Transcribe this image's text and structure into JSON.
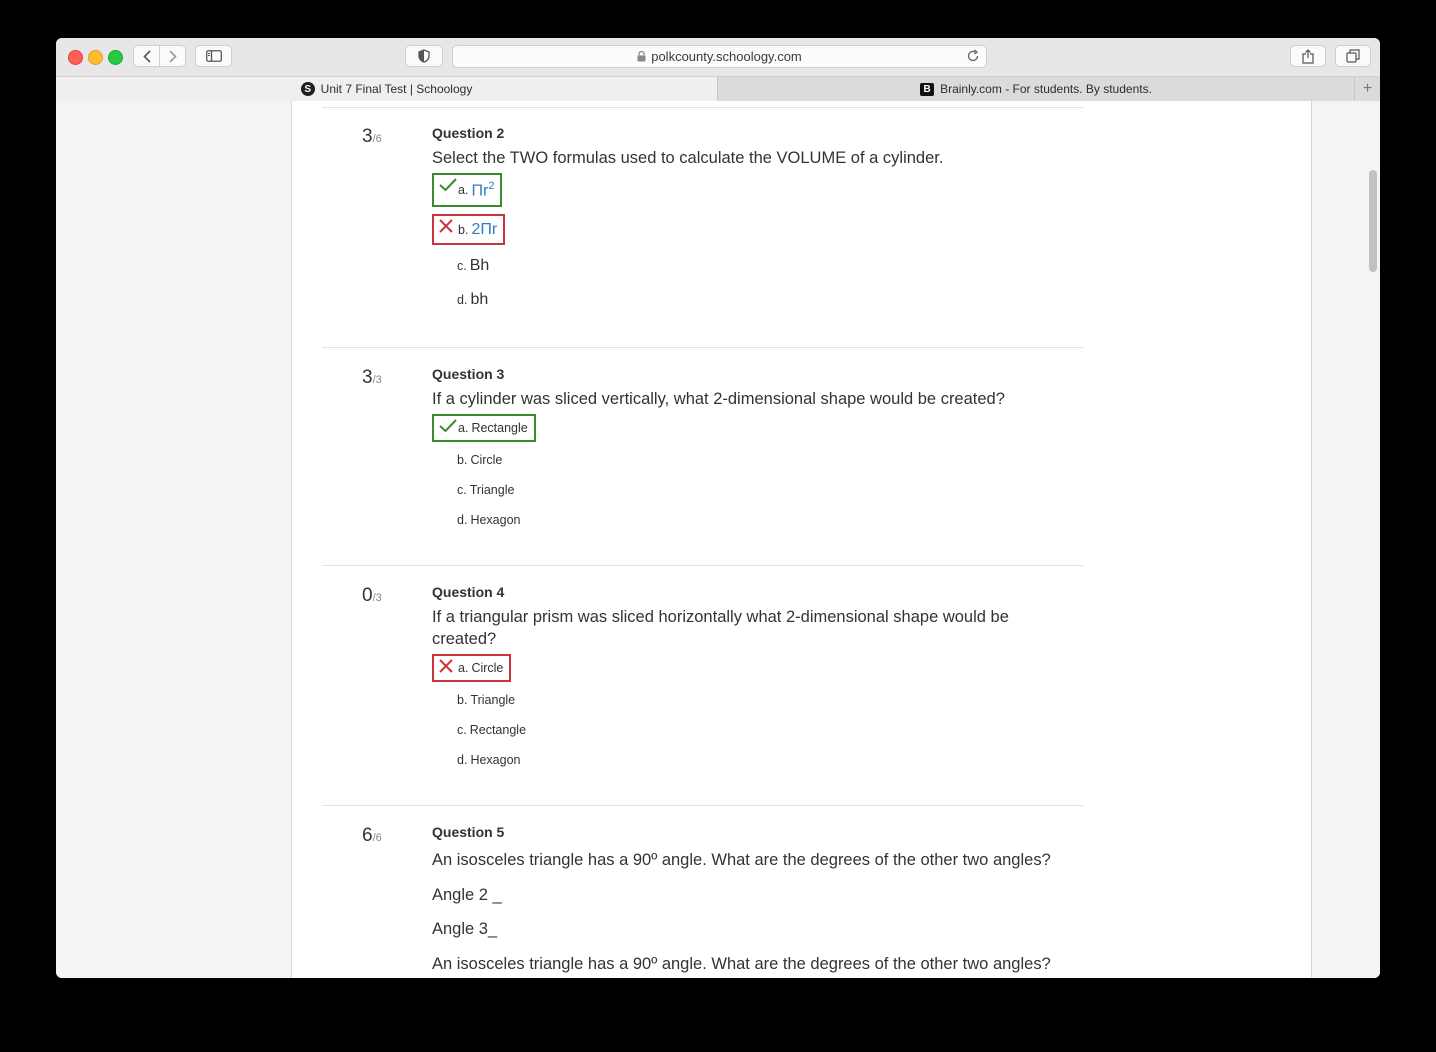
{
  "browser": {
    "url": "polkcounty.schoology.com",
    "tabs": [
      {
        "label": "Unit 7 Final Test | Schoology",
        "favicon": "S"
      },
      {
        "label": "Brainly.com - For students. By students.",
        "favicon": "B"
      }
    ],
    "new_tab": "+"
  },
  "questions": [
    {
      "score": "3",
      "max": "/6",
      "title": "Question 2",
      "text": "Select the TWO formulas used to calculate the VOLUME of a cylinder.",
      "choices": [
        {
          "letter": "a.",
          "label": "Πr",
          "sup": "2",
          "status": "correct"
        },
        {
          "letter": "b.",
          "label": "2Πr",
          "status": "wrong"
        },
        {
          "letter": "c.",
          "label": "Bh",
          "status": "none"
        },
        {
          "letter": "d.",
          "label": "bh",
          "status": "none"
        }
      ]
    },
    {
      "score": "3",
      "max": "/3",
      "title": "Question 3",
      "text": "If a cylinder was sliced vertically, what 2-dimensional shape would be created?",
      "choices": [
        {
          "letter": "a.",
          "label": "Rectangle",
          "status": "correct"
        },
        {
          "letter": "b.",
          "label": "Circle",
          "status": "none"
        },
        {
          "letter": "c.",
          "label": "Triangle",
          "status": "none"
        },
        {
          "letter": "d.",
          "label": "Hexagon",
          "status": "none"
        }
      ]
    },
    {
      "score": "0",
      "max": "/3",
      "title": "Question 4",
      "text": "If a triangular prism was sliced horizontally what 2-dimensional shape would be created?",
      "choices": [
        {
          "letter": "a.",
          "label": "Circle",
          "status": "wrong"
        },
        {
          "letter": "b.",
          "label": "Triangle",
          "status": "none"
        },
        {
          "letter": "c.",
          "label": "Rectangle",
          "status": "none"
        },
        {
          "letter": "d.",
          "label": "Hexagon",
          "status": "none"
        }
      ]
    },
    {
      "score": "6",
      "max": "/6",
      "title": "Question 5",
      "text": "An isosceles triangle has a 90º angle. What are the degrees of the other two angles?",
      "lines": [
        "Angle 2 _",
        "Angle 3_"
      ],
      "repeat_text": "An isosceles triangle has a 90º angle. What are the degrees of the other two angles?"
    }
  ],
  "colors": {
    "correct": "#3b8a2e",
    "wrong": "#c9353b",
    "math": "#2f7bc4"
  }
}
